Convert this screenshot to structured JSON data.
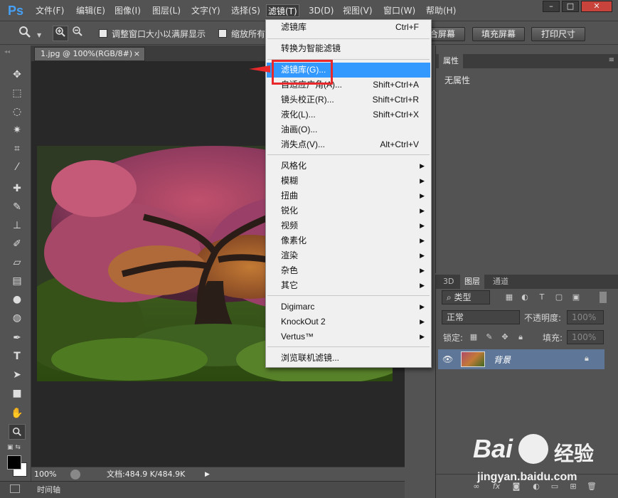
{
  "app": {
    "logo": "Ps"
  },
  "menubar": {
    "items": [
      "文件(F)",
      "编辑(E)",
      "图像(I)",
      "图层(L)",
      "文字(Y)",
      "选择(S)",
      "滤镜(T)",
      "3D(D)",
      "视图(V)",
      "窗口(W)",
      "帮助(H)"
    ],
    "active_index": 6
  },
  "window_controls": [
    "–",
    "□",
    "✕"
  ],
  "options_bar": {
    "checkbox1_label": "调整窗口大小以满屏显示",
    "checkbox2_label": "缩放所有",
    "buttons": [
      "合屏幕",
      "填充屏幕",
      "打印尺寸"
    ]
  },
  "document": {
    "tab_title": "1.jpg @ 100%(RGB/8#)",
    "tab_close": "×"
  },
  "status": {
    "zoom": "100%",
    "doc_info": "文档:484.9 K/484.9K",
    "timeline": "时间轴"
  },
  "properties_panel": {
    "tab": "属性",
    "content": "无属性"
  },
  "layers_panel": {
    "tabs": [
      "3D",
      "图层",
      "通道"
    ],
    "active_tab": 1,
    "kind_filter": "类型",
    "blend_mode": "正常",
    "opacity_label": "不透明度:",
    "opacity_value": "100%",
    "lock_label": "锁定:",
    "fill_label": "填充:",
    "fill_value": "100%",
    "layer_name": "背景"
  },
  "filter_menu": {
    "items": [
      {
        "label": "滤镜库",
        "shortcut": "Ctrl+F"
      },
      {
        "label": "转换为智能滤镜",
        "shortcut": ""
      },
      {
        "label": "滤镜库(G)...",
        "shortcut": "",
        "highlighted": true
      },
      {
        "label": "自适应广角(A)...",
        "shortcut": "Shift+Ctrl+A"
      },
      {
        "label": "镜头校正(R)...",
        "shortcut": "Shift+Ctrl+R"
      },
      {
        "label": "液化(L)...",
        "shortcut": "Shift+Ctrl+X"
      },
      {
        "label": "油画(O)...",
        "shortcut": ""
      },
      {
        "label": "消失点(V)...",
        "shortcut": "Alt+Ctrl+V"
      },
      {
        "label": "风格化",
        "submenu": true
      },
      {
        "label": "模糊",
        "submenu": true
      },
      {
        "label": "扭曲",
        "submenu": true
      },
      {
        "label": "锐化",
        "submenu": true
      },
      {
        "label": "视频",
        "submenu": true
      },
      {
        "label": "像素化",
        "submenu": true
      },
      {
        "label": "渲染",
        "submenu": true
      },
      {
        "label": "杂色",
        "submenu": true
      },
      {
        "label": "其它",
        "submenu": true
      },
      {
        "label": "Digimarc",
        "submenu": true
      },
      {
        "label": "KnockOut 2",
        "submenu": true
      },
      {
        "label": "Vertus™",
        "submenu": true
      },
      {
        "label": "浏览联机滤镜...",
        "shortcut": ""
      }
    ]
  },
  "watermark": {
    "brand": "Bai",
    "brand_cn": "经验",
    "url": "jingyan.baidu.com"
  },
  "colors": {
    "accent": "#3399ff",
    "highlight_red": "#e8282a",
    "layer_selected": "#5e7798"
  }
}
